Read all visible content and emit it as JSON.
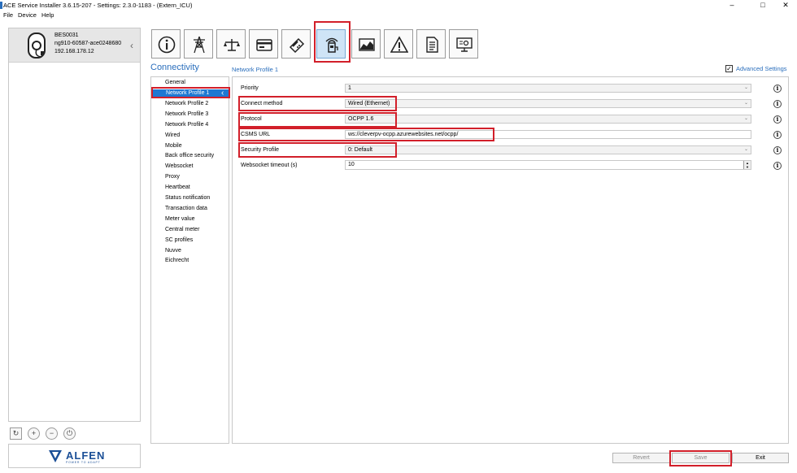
{
  "window": {
    "title": "ACE Service Installer 3.6.15-207 - Settings: 2.3.0-1183 - (Extern_ICU)",
    "controls": [
      "–",
      "□",
      "✕"
    ]
  },
  "menu": [
    "File",
    "Device",
    "Help"
  ],
  "device": {
    "name": "BES0031",
    "id": "ng910-60587-ace0248680",
    "ip": "192.168.178.12"
  },
  "left_tools": [
    "refresh-icon",
    "add-icon",
    "remove-icon",
    "power-icon"
  ],
  "logo": {
    "name": "ALFEN",
    "tagline": "POWER TO ADAPT"
  },
  "toolbar": [
    {
      "icon": "info-icon"
    },
    {
      "icon": "power-pylon-icon"
    },
    {
      "icon": "balance-icon"
    },
    {
      "icon": "card-reader-icon"
    },
    {
      "icon": "payment-terminal-icon"
    },
    {
      "icon": "connectivity-icon",
      "active": true
    },
    {
      "icon": "chart-icon"
    },
    {
      "icon": "warning-icon"
    },
    {
      "icon": "document-icon"
    },
    {
      "icon": "monitor-settings-icon"
    }
  ],
  "section_title": "Connectivity",
  "sub_title": "Network Profile 1",
  "advanced": {
    "label": "Advanced Settings",
    "checked": true
  },
  "nav": {
    "items": [
      "General",
      "Network Profile 1",
      "Network Profile 2",
      "Network Profile 3",
      "Network Profile 4",
      "Wired",
      "Mobile",
      "Back office security",
      "Websocket",
      "Proxy",
      "Heartbeat",
      "Status notification",
      "Transaction data",
      "Meter value",
      "Central meter",
      "SC profiles",
      "Nuvve",
      "Eichrecht"
    ],
    "selected": "Network Profile 1"
  },
  "form": {
    "priority": {
      "label": "Priority",
      "value": "1"
    },
    "connect_method": {
      "label": "Connect method",
      "value": "Wired (Ethernet)"
    },
    "protocol": {
      "label": "Protocol",
      "value": "OCPP 1.6"
    },
    "csms_url": {
      "label": "CSMS URL",
      "value": "ws://cleverpv-ocpp.azurewebsites.net/ocpp/"
    },
    "security_profile": {
      "label": "Security Profile",
      "value": "0: Default"
    },
    "websocket_timeout": {
      "label": "Websocket timeout (s)",
      "value": "10"
    }
  },
  "buttons": {
    "revert": "Revert",
    "save": "Save",
    "exit": "Exit"
  },
  "colors": {
    "accent": "#2a6ebc",
    "selection": "#1e78d2",
    "highlight": "#d21f2a",
    "active_tool": "#cfe4f6"
  }
}
